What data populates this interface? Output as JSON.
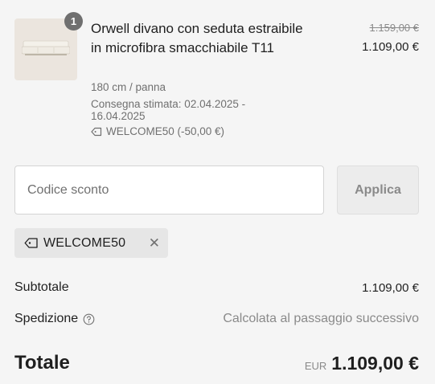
{
  "product": {
    "quantity": "1",
    "name": "Orwell divano con seduta estraibile in microfibra smacchiabile T11",
    "price_original": "1.159,00 €",
    "price_current": "1.109,00 €",
    "variant": "180 cm / panna",
    "delivery": "Consegna stimata: 02.04.2025 - 16.04.2025",
    "discount_line": "WELCOME50 (-50,00 €)",
    "image_icon": "sofa-image"
  },
  "discount": {
    "placeholder": "Codice sconto",
    "apply_label": "Applica",
    "applied_code": "WELCOME50"
  },
  "summary": {
    "subtotal_label": "Subtotale",
    "subtotal_value": "1.109,00 €",
    "shipping_label": "Spedizione",
    "shipping_value": "Calcolata al passaggio successivo",
    "total_label": "Totale",
    "total_currency": "EUR",
    "total_value": "1.109,00 €"
  },
  "colors": {
    "background": "#f5f5f5",
    "text": "#1f1f1f",
    "muted": "#707070",
    "badge": "#6f6f6f"
  }
}
